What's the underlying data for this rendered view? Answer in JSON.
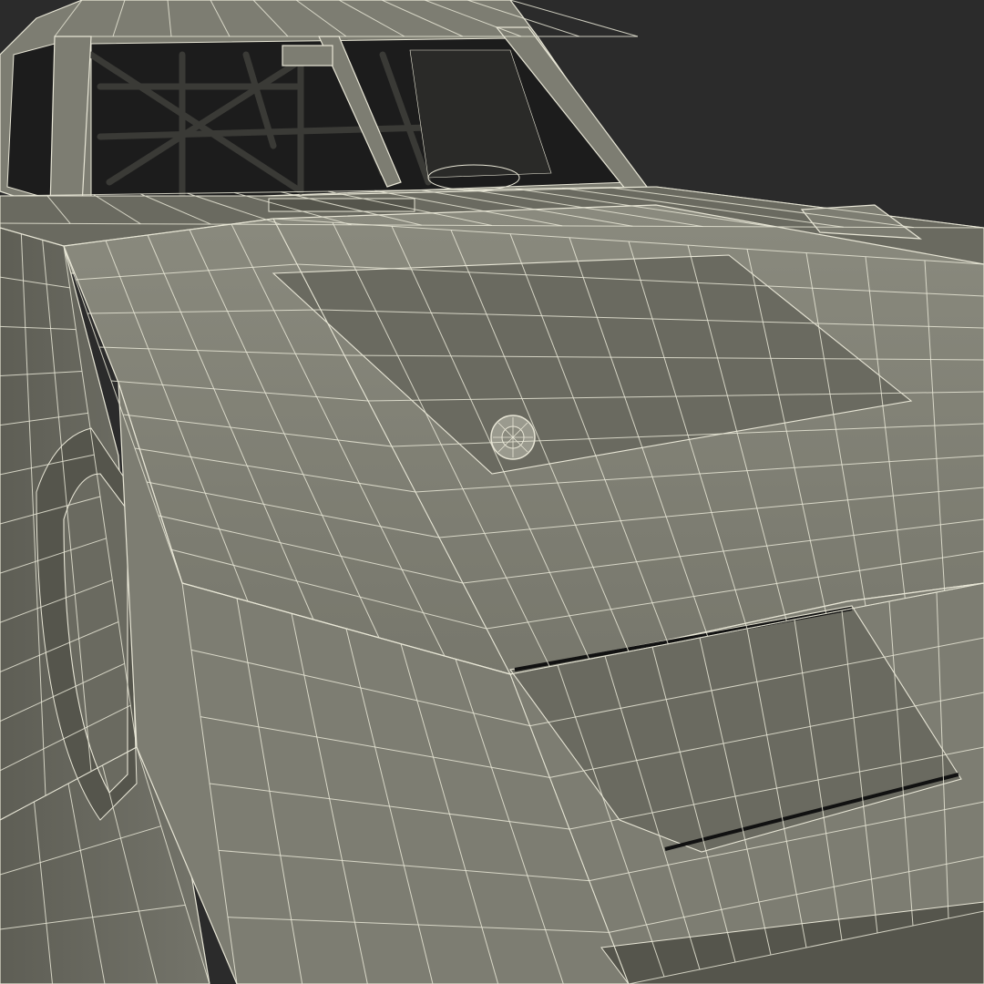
{
  "scene": {
    "background_color": "#2b2b2b",
    "body_color": "#7d7d72",
    "body_shade_color": "#6a6a60",
    "body_dark_color": "#55554c",
    "wire_color": "#e8e6d6",
    "glass_color": "#1c1c1c",
    "edge_dark_color": "#111111",
    "icons": [
      "hood-emblem-icon"
    ]
  }
}
